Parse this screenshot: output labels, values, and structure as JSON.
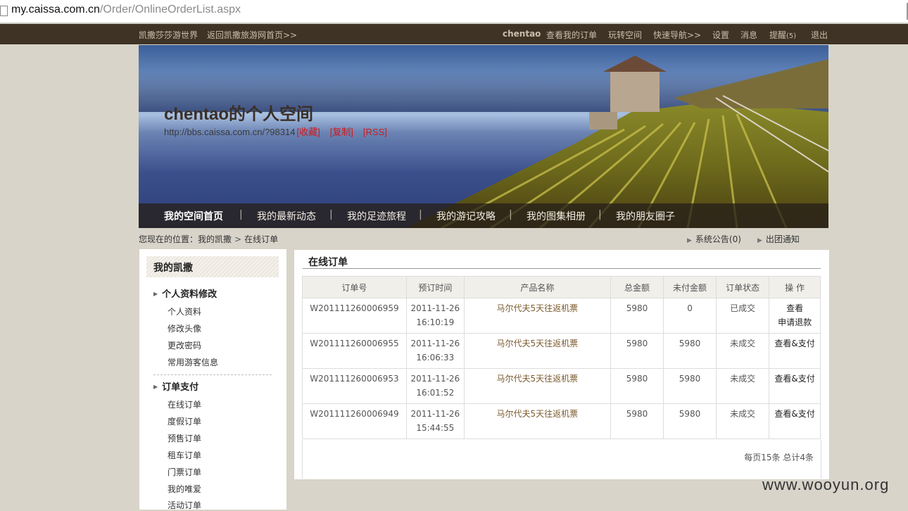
{
  "browser": {
    "url_host": "my.caissa.com.cn",
    "url_path": "/Order/OnlineOrderList.aspx"
  },
  "topnav": {
    "left_links": [
      "凯撒莎莎游世界",
      "返回凯撒旅游网首页>>"
    ],
    "username": "chentao",
    "right_links": [
      "查看我的订单",
      "玩转空间",
      "快速导航>>",
      "设置",
      "消息",
      "提醒"
    ],
    "reminder_count": "(5)",
    "logout": "退出"
  },
  "banner": {
    "title": "chentao的个人空间",
    "space_url": "http://bbs.caissa.com.cn/?98314",
    "actions": [
      "[收藏]",
      "[复制]",
      "[RSS]"
    ],
    "menu": [
      "我的空间首页",
      "我的最新动态",
      "我的足迹旅程",
      "我的游记攻略",
      "我的图集相册",
      "我的朋友圈子"
    ],
    "menu_separator": "|"
  },
  "breadcrumb": {
    "prefix": "您现在的位置：",
    "items": [
      "我的凯撒",
      "在线订单"
    ],
    "separator": ">"
  },
  "notices": [
    "系统公告(0)",
    "出团通知"
  ],
  "sidebar": {
    "header": "我的凯撒",
    "groups": [
      {
        "label": "个人资料修改",
        "items": [
          "个人资料",
          "修改头像",
          "更改密码",
          "常用游客信息"
        ]
      },
      {
        "label": "订单支付",
        "items": [
          "在线订单",
          "度假订单",
          "预售订单",
          "租车订单",
          "门票订单",
          "我的唯爱",
          "活动订单"
        ]
      }
    ]
  },
  "orders_panel": {
    "title": "在线订单",
    "columns": [
      "订单号",
      "预订时间",
      "产品名称",
      "总金额",
      "未付金额",
      "订单状态",
      "操 作"
    ],
    "rows": [
      {
        "order_no": "W201111260006959",
        "date": "2011-11-26",
        "time": "16:10:19",
        "product": "马尔代夫5天往返机票",
        "total": "5980",
        "unpaid": "0",
        "status": "已成交",
        "ops": [
          "查看",
          "申请退款"
        ]
      },
      {
        "order_no": "W201111260006955",
        "date": "2011-11-26",
        "time": "16:06:33",
        "product": "马尔代夫5天往返机票",
        "total": "5980",
        "unpaid": "5980",
        "status": "未成交",
        "ops": [
          "查看&支付"
        ]
      },
      {
        "order_no": "W201111260006953",
        "date": "2011-11-26",
        "time": "16:01:52",
        "product": "马尔代夫5天往返机票",
        "total": "5980",
        "unpaid": "5980",
        "status": "未成交",
        "ops": [
          "查看&支付"
        ]
      },
      {
        "order_no": "W201111260006949",
        "date": "2011-11-26",
        "time": "15:44:55",
        "product": "马尔代夫5天往返机票",
        "total": "5980",
        "unpaid": "5980",
        "status": "未成交",
        "ops": [
          "查看&支付"
        ]
      }
    ],
    "pager_text": "每页15条 总计4条"
  },
  "watermark": "www.wooyun.org",
  "colors": {
    "topnav_bg": "#3e3325",
    "accent_red": "#d01818",
    "page_bg": "#d8d4ca"
  }
}
